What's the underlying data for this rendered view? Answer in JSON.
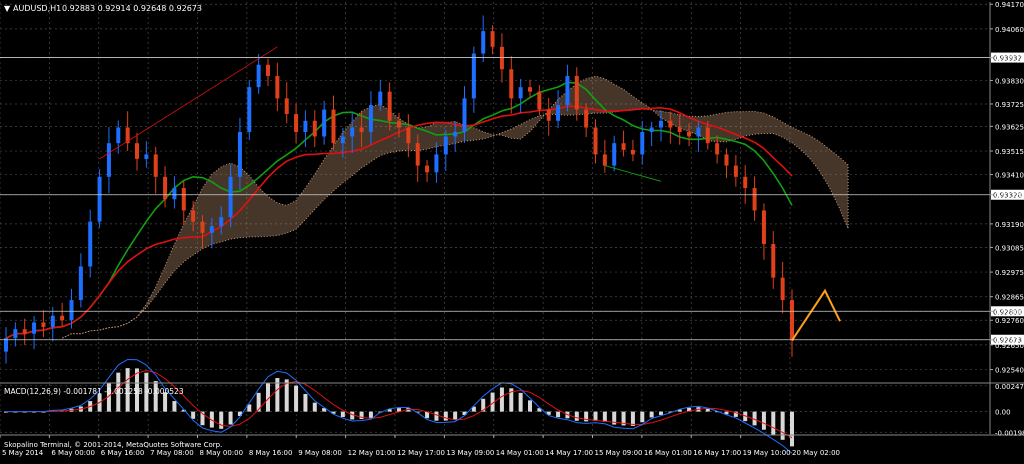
{
  "header": {
    "symbol": "AUDUSD,H1",
    "ohlc": "0.92883 0.92914 0.92648 0.92673"
  },
  "footer": {
    "copyright": "Skopalino Terminal, © 2001-2014, MetaQuotes Software Corp."
  },
  "macd": {
    "label": "MACD(12,26,9) -0.001781 -0.001258 -0.000523"
  },
  "colors": {
    "background": "#000000",
    "grid": "#4a4a4a",
    "bull": "#1e6fff",
    "bear": "#e0401a",
    "ma_red": "#e01010",
    "ma_green": "#10a010",
    "cloud": "#c89a78",
    "projection": "#ff9f1a"
  },
  "chart_data": [
    {
      "type": "candlestick",
      "title": "AUDUSD,H1",
      "y_ticks": [
        "0.94170",
        "0.94060",
        "0.93932",
        "0.93830",
        "0.93725",
        "0.93625",
        "0.93515",
        "0.93410",
        "0.93320",
        "0.93190",
        "0.93085",
        "0.92975",
        "0.92865",
        "0.92800",
        "0.92760",
        "0.92673",
        "0.92650",
        "0.92540"
      ],
      "ylim": [
        0.9248,
        0.9418
      ],
      "x_ticks": [
        "5 May 2014",
        "6 May 00:00",
        "6 May 16:00",
        "7 May 08:00",
        "8 May 00:00",
        "8 May 16:00",
        "9 May 08:00",
        "12 May 01:00",
        "12 May 17:00",
        "13 May 09:00",
        "14 May 01:00",
        "14 May 17:00",
        "15 May 09:00",
        "16 May 01:00",
        "16 May 17:00",
        "19 May 10:00",
        "20 May 02:00"
      ],
      "price_levels": [
        {
          "label": "0.93932",
          "value": 0.93932
        },
        {
          "label": "0.93320",
          "value": 0.9332
        },
        {
          "label": "0.92800",
          "value": 0.928
        },
        {
          "label": "0.92673",
          "value": 0.92673
        }
      ],
      "series": [
        {
          "name": "close",
          "values": [
            0.9268,
            0.9272,
            0.927,
            0.9275,
            0.9273,
            0.9278,
            0.9276,
            0.9285,
            0.93,
            0.932,
            0.934,
            0.9355,
            0.9362,
            0.9355,
            0.9348,
            0.935,
            0.934,
            0.933,
            0.9335,
            0.9325,
            0.932,
            0.9315,
            0.9318,
            0.9322,
            0.934,
            0.936,
            0.938,
            0.939,
            0.9385,
            0.9375,
            0.9368,
            0.936,
            0.9365,
            0.9358,
            0.937,
            0.9355,
            0.9358,
            0.9362,
            0.936,
            0.9372,
            0.9378,
            0.9365,
            0.9362,
            0.9355,
            0.9345,
            0.9342,
            0.935,
            0.9358,
            0.936,
            0.9375,
            0.9395,
            0.9405,
            0.9398,
            0.9388,
            0.9375,
            0.938,
            0.9378,
            0.937,
            0.9365,
            0.9372,
            0.9385,
            0.937,
            0.9362,
            0.935,
            0.9345,
            0.9355,
            0.9352,
            0.935,
            0.936,
            0.9362,
            0.9365,
            0.9362,
            0.936,
            0.9358,
            0.9362,
            0.9355,
            0.935,
            0.9345,
            0.934,
            0.9335,
            0.9325,
            0.931,
            0.9295,
            0.9285,
            0.9267
          ]
        }
      ]
    },
    {
      "type": "bar",
      "title": "MACD(12,26,9) -0.001781 -0.001258 -0.000523",
      "y_ticks": [
        "0.002475",
        "0.00",
        "-0.001984"
      ],
      "ylim": [
        -0.00215,
        0.00265
      ]
    }
  ]
}
